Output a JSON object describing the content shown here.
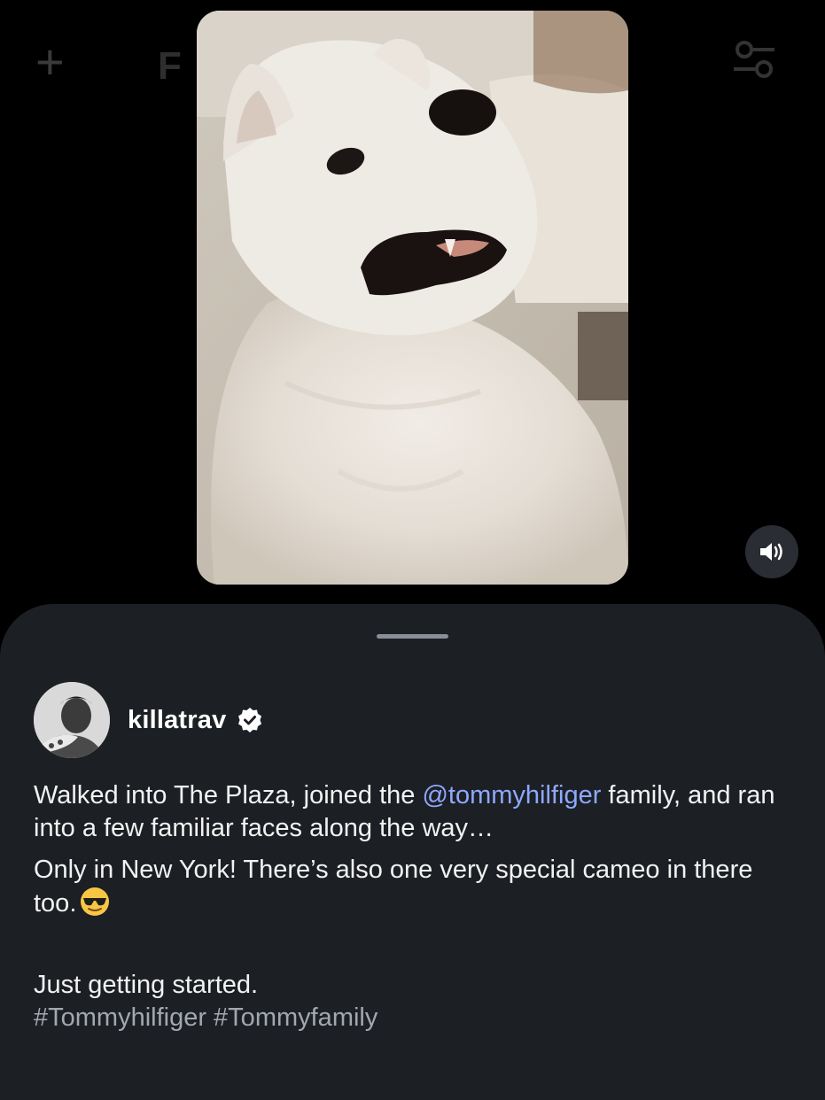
{
  "top_bar": {
    "left_icon": "plus-icon",
    "right_icon": "filter-icon",
    "faded_label": "F"
  },
  "video": {
    "subject": "white fluffy dog photo",
    "sound_icon": "speaker-icon"
  },
  "post": {
    "username": "killatrav",
    "verified_icon": "verified-badge-icon",
    "caption_line1_a": "Walked into The Plaza, joined the ",
    "caption_mention": "@tommyhilfiger",
    "caption_line1_b": " family, and ran into a few familiar faces along the way…",
    "caption_para2": "Only in New York! There’s also one very special cameo in there too.",
    "caption_emoji": "sunglasses-emoji-icon",
    "caption_para3": "Just getting started.",
    "hashtags": "#Tommyhilfiger #Tommyfamily"
  },
  "colors": {
    "background": "#000000",
    "sheet": "#1c1f24",
    "mention": "#8ea8ff",
    "hashtag": "#a3a7ae"
  }
}
